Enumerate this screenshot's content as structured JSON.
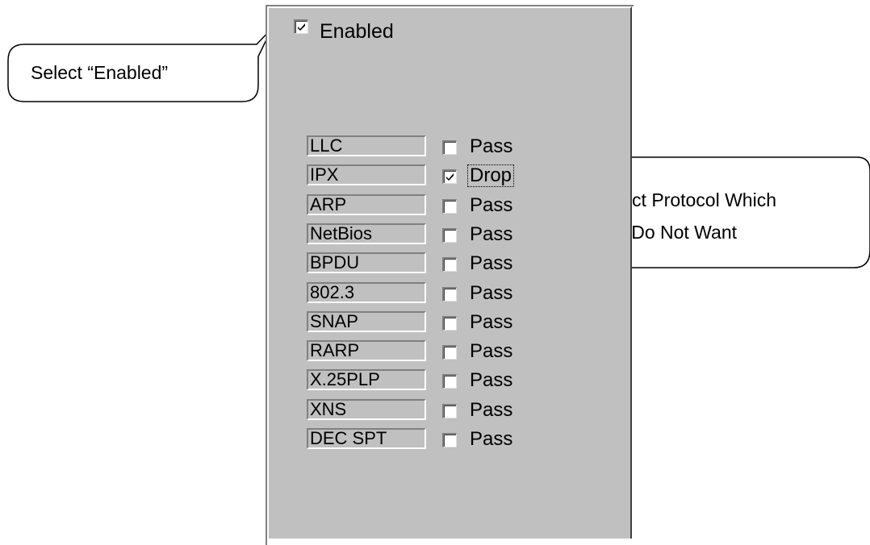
{
  "enabled": {
    "label": "Enabled",
    "checked": true
  },
  "protocols": [
    {
      "name": "LLC",
      "action": "Pass",
      "checked": false
    },
    {
      "name": "IPX",
      "action": "Drop",
      "checked": true
    },
    {
      "name": "ARP",
      "action": "Pass",
      "checked": false
    },
    {
      "name": "NetBios",
      "action": "Pass",
      "checked": false
    },
    {
      "name": "BPDU",
      "action": "Pass",
      "checked": false
    },
    {
      "name": "802.3",
      "action": "Pass",
      "checked": false
    },
    {
      "name": "SNAP",
      "action": "Pass",
      "checked": false
    },
    {
      "name": "RARP",
      "action": "Pass",
      "checked": false
    },
    {
      "name": "X.25PLP",
      "action": "Pass",
      "checked": false
    },
    {
      "name": "XNS",
      "action": "Pass",
      "checked": false
    },
    {
      "name": "DEC SPT",
      "action": "Pass",
      "checked": false
    }
  ],
  "callouts": {
    "enabled": "Select “Enabled”",
    "protocol_line1": "Select Protocol Which",
    "protocol_line2": "You Do Not Want"
  }
}
